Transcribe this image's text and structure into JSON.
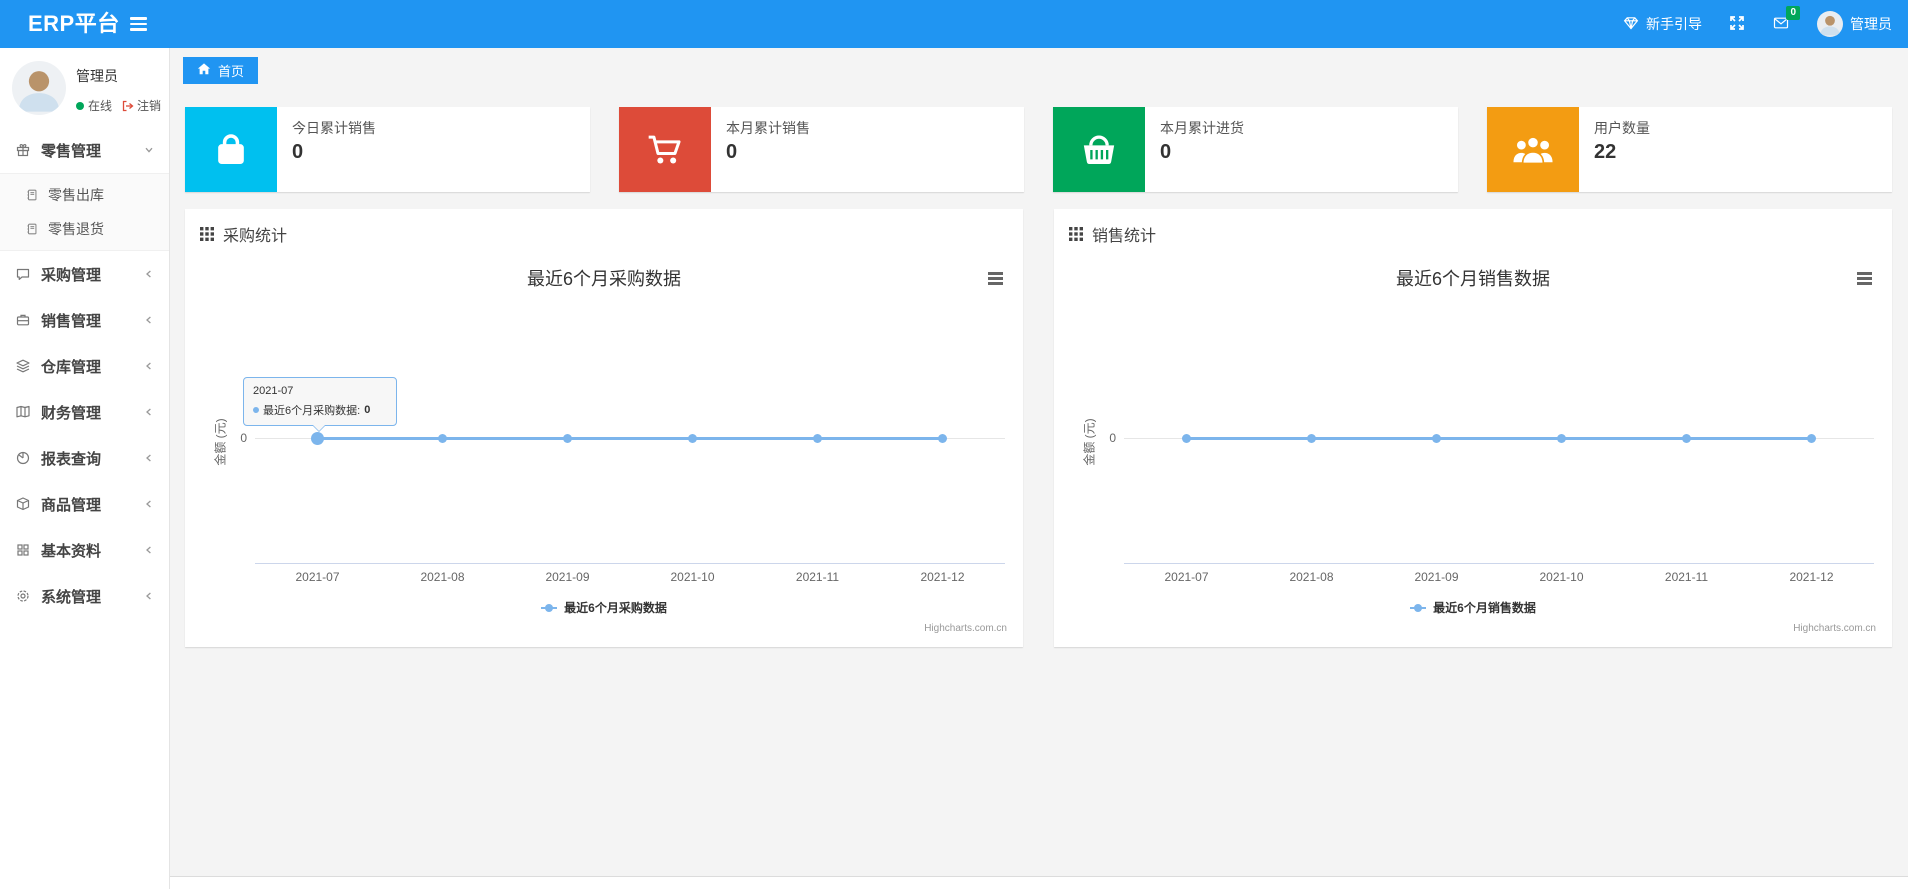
{
  "navbar": {
    "brand": "ERP平台",
    "guide_label": "新手引导",
    "message_badge": "0",
    "username": "管理员"
  },
  "sidebar": {
    "user": {
      "name": "管理员",
      "status": "在线",
      "logout": "注销"
    },
    "items": [
      {
        "label": "零售管理",
        "icon": "gift-icon",
        "state": "expanded"
      },
      {
        "label": "采购管理",
        "icon": "comment-icon",
        "state": "collapsed"
      },
      {
        "label": "销售管理",
        "icon": "briefcase-icon",
        "state": "collapsed"
      },
      {
        "label": "仓库管理",
        "icon": "layers-icon",
        "state": "collapsed"
      },
      {
        "label": "财务管理",
        "icon": "ledger-icon",
        "state": "collapsed"
      },
      {
        "label": "报表查询",
        "icon": "pie-chart-icon",
        "state": "collapsed"
      },
      {
        "label": "商品管理",
        "icon": "package-icon",
        "state": "collapsed"
      },
      {
        "label": "基本资料",
        "icon": "grid-icon",
        "state": "collapsed"
      },
      {
        "label": "系统管理",
        "icon": "gear-icon",
        "state": "collapsed"
      }
    ],
    "subitems": [
      {
        "label": "零售出库",
        "icon": "journal-icon"
      },
      {
        "label": "零售退货",
        "icon": "journal-icon"
      }
    ]
  },
  "breadcrumb": {
    "home_label": "首页"
  },
  "stats": {
    "cards": [
      {
        "label": "今日累计销售",
        "value": "0",
        "color": "#00c0ef",
        "icon": "shopping-bag-icon"
      },
      {
        "label": "本月累计销售",
        "value": "0",
        "color": "#dd4b39",
        "icon": "shopping-cart-icon"
      },
      {
        "label": "本月累计进货",
        "value": "0",
        "color": "#00a65a",
        "icon": "shopping-basket-icon"
      },
      {
        "label": "用户数量",
        "value": "22",
        "color": "#f39c12",
        "icon": "users-icon"
      }
    ]
  },
  "panels": [
    {
      "title": "采购统计"
    },
    {
      "title": "销售统计"
    }
  ],
  "chart_data": [
    {
      "type": "line",
      "title": "最近6个月采购数据",
      "categories": [
        "2021-07",
        "2021-08",
        "2021-09",
        "2021-10",
        "2021-11",
        "2021-12"
      ],
      "series": [
        {
          "name": "最近6个月采购数据",
          "values": [
            0,
            0,
            0,
            0,
            0,
            0
          ]
        }
      ],
      "xlabel": "",
      "ylabel": "金额 (元)",
      "ytick_label": "0",
      "line_color": "#7cb5ec",
      "grid": true,
      "legend_position": "bottom",
      "credits": "Highcharts.com.cn",
      "tooltip": {
        "category": "2021-07",
        "series_label": "最近6个月采购数据:",
        "value": "0"
      }
    },
    {
      "type": "line",
      "title": "最近6个月销售数据",
      "categories": [
        "2021-07",
        "2021-08",
        "2021-09",
        "2021-10",
        "2021-11",
        "2021-12"
      ],
      "series": [
        {
          "name": "最近6个月销售数据",
          "values": [
            0,
            0,
            0,
            0,
            0,
            0
          ]
        }
      ],
      "xlabel": "",
      "ylabel": "金额 (元)",
      "ytick_label": "0",
      "line_color": "#7cb5ec",
      "grid": true,
      "legend_position": "bottom",
      "credits": "Highcharts.com.cn"
    }
  ]
}
